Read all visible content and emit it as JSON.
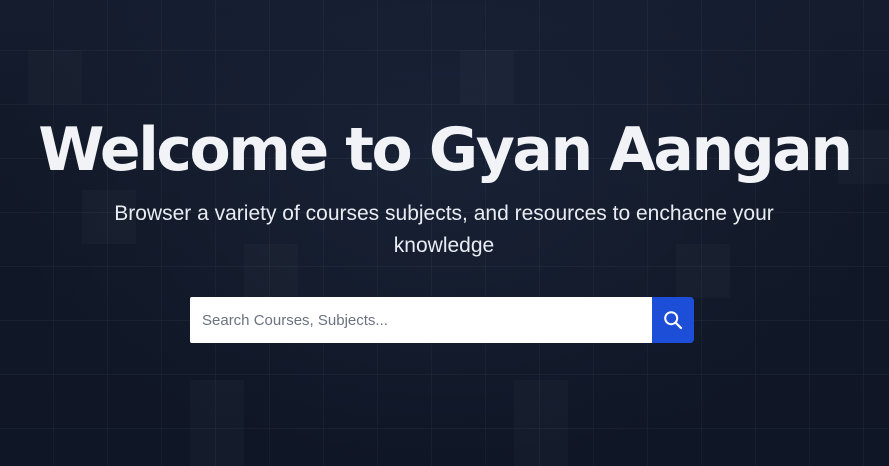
{
  "hero": {
    "title": "Welcome to Gyan Aangan",
    "subtitle": "Browser a variety of courses subjects, and resources to enchacne your knowledge"
  },
  "search": {
    "placeholder": "Search Courses, Subjects...",
    "value": "",
    "button_icon": "search-icon",
    "button_color": "#1d4ed8"
  },
  "colors": {
    "background": "#111827",
    "text": "#f1f3f6"
  }
}
